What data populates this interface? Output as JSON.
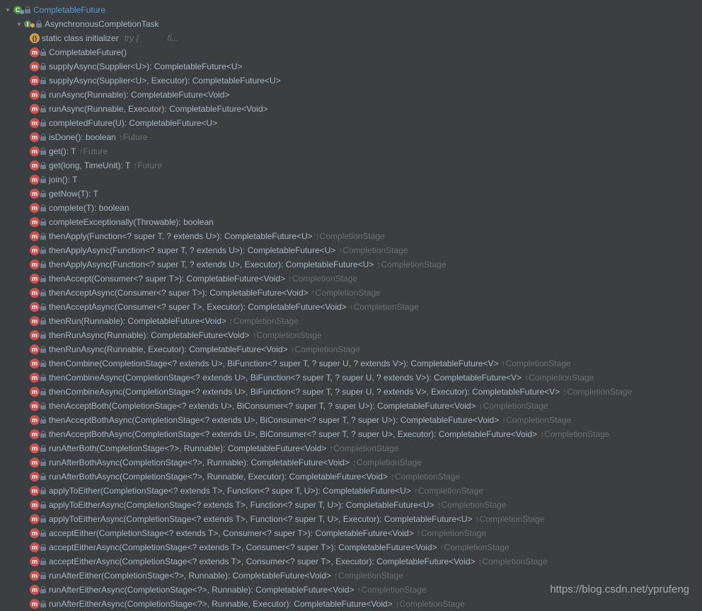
{
  "root": {
    "label": "CompletableFuture"
  },
  "sub": {
    "label": "AsynchronousCompletionTask"
  },
  "static_init": {
    "label": "static class initializer",
    "ghost1": "try {",
    "ghost2": "fi..."
  },
  "members": [
    {
      "sig": "CompletableFuture()",
      "kind": "m",
      "inherit": ""
    },
    {
      "sig": "supplyAsync(Supplier<U>): CompletableFuture<U>",
      "kind": "m",
      "inherit": ""
    },
    {
      "sig": "supplyAsync(Supplier<U>, Executor): CompletableFuture<U>",
      "kind": "m",
      "inherit": ""
    },
    {
      "sig": "runAsync(Runnable): CompletableFuture<Void>",
      "kind": "m",
      "inherit": ""
    },
    {
      "sig": "runAsync(Runnable, Executor): CompletableFuture<Void>",
      "kind": "m",
      "inherit": ""
    },
    {
      "sig": "completedFuture(U): CompletableFuture<U>",
      "kind": "m",
      "inherit": ""
    },
    {
      "sig": "isDone(): boolean",
      "kind": "m",
      "inherit": "Future"
    },
    {
      "sig": "get(): T",
      "kind": "m",
      "inherit": "Future"
    },
    {
      "sig": "get(long, TimeUnit): T",
      "kind": "m",
      "inherit": "Future"
    },
    {
      "sig": "join(): T",
      "kind": "m",
      "inherit": ""
    },
    {
      "sig": "getNow(T): T",
      "kind": "m",
      "inherit": ""
    },
    {
      "sig": "complete(T): boolean",
      "kind": "m",
      "inherit": ""
    },
    {
      "sig": "completeExceptionally(Throwable): boolean",
      "kind": "m",
      "inherit": ""
    },
    {
      "sig": "thenApply(Function<? super T, ? extends U>): CompletableFuture<U>",
      "kind": "m",
      "inherit": "CompletionStage"
    },
    {
      "sig": "thenApplyAsync(Function<? super T, ? extends U>): CompletableFuture<U>",
      "kind": "m",
      "inherit": "CompletionStage"
    },
    {
      "sig": "thenApplyAsync(Function<? super T, ? extends U>, Executor): CompletableFuture<U>",
      "kind": "m",
      "inherit": "CompletionStage"
    },
    {
      "sig": "thenAccept(Consumer<? super T>): CompletableFuture<Void>",
      "kind": "m",
      "inherit": "CompletionStage"
    },
    {
      "sig": "thenAcceptAsync(Consumer<? super T>): CompletableFuture<Void>",
      "kind": "m",
      "inherit": "CompletionStage"
    },
    {
      "sig": "thenAcceptAsync(Consumer<? super T>, Executor): CompletableFuture<Void>",
      "kind": "m",
      "inherit": "CompletionStage"
    },
    {
      "sig": "thenRun(Runnable): CompletableFuture<Void>",
      "kind": "m",
      "inherit": "CompletionStage"
    },
    {
      "sig": "thenRunAsync(Runnable): CompletableFuture<Void>",
      "kind": "m",
      "inherit": "CompletionStage"
    },
    {
      "sig": "thenRunAsync(Runnable, Executor): CompletableFuture<Void>",
      "kind": "m",
      "inherit": "CompletionStage"
    },
    {
      "sig": "thenCombine(CompletionStage<? extends U>, BiFunction<? super T, ? super U, ? extends V>): CompletableFuture<V>",
      "kind": "m",
      "inherit": "CompletionStage"
    },
    {
      "sig": "thenCombineAsync(CompletionStage<? extends U>, BiFunction<? super T, ? super U, ? extends V>): CompletableFuture<V>",
      "kind": "m",
      "inherit": "CompletionStage"
    },
    {
      "sig": "thenCombineAsync(CompletionStage<? extends U>, BiFunction<? super T, ? super U, ? extends V>, Executor): CompletableFuture<V>",
      "kind": "m",
      "inherit": "CompletionStage"
    },
    {
      "sig": "thenAcceptBoth(CompletionStage<? extends U>, BiConsumer<? super T, ? super U>): CompletableFuture<Void>",
      "kind": "m",
      "inherit": "CompletionStage"
    },
    {
      "sig": "thenAcceptBothAsync(CompletionStage<? extends U>, BiConsumer<? super T, ? super U>): CompletableFuture<Void>",
      "kind": "m",
      "inherit": "CompletionStage"
    },
    {
      "sig": "thenAcceptBothAsync(CompletionStage<? extends U>, BiConsumer<? super T, ? super U>, Executor): CompletableFuture<Void>",
      "kind": "m",
      "inherit": "CompletionStage"
    },
    {
      "sig": "runAfterBoth(CompletionStage<?>, Runnable): CompletableFuture<Void>",
      "kind": "m",
      "inherit": "CompletionStage"
    },
    {
      "sig": "runAfterBothAsync(CompletionStage<?>, Runnable): CompletableFuture<Void>",
      "kind": "m",
      "inherit": "CompletionStage"
    },
    {
      "sig": "runAfterBothAsync(CompletionStage<?>, Runnable, Executor): CompletableFuture<Void>",
      "kind": "m",
      "inherit": "CompletionStage"
    },
    {
      "sig": "applyToEither(CompletionStage<? extends T>, Function<? super T, U>): CompletableFuture<U>",
      "kind": "m",
      "inherit": "CompletionStage"
    },
    {
      "sig": "applyToEitherAsync(CompletionStage<? extends T>, Function<? super T, U>): CompletableFuture<U>",
      "kind": "m",
      "inherit": "CompletionStage"
    },
    {
      "sig": "applyToEitherAsync(CompletionStage<? extends T>, Function<? super T, U>, Executor): CompletableFuture<U>",
      "kind": "m",
      "inherit": "CompletionStage"
    },
    {
      "sig": "acceptEither(CompletionStage<? extends T>, Consumer<? super T>): CompletableFuture<Void>",
      "kind": "m",
      "inherit": "CompletionStage"
    },
    {
      "sig": "acceptEitherAsync(CompletionStage<? extends T>, Consumer<? super T>): CompletableFuture<Void>",
      "kind": "m",
      "inherit": "CompletionStage"
    },
    {
      "sig": "acceptEitherAsync(CompletionStage<? extends T>, Consumer<? super T>, Executor): CompletableFuture<Void>",
      "kind": "m",
      "inherit": "CompletionStage"
    },
    {
      "sig": "runAfterEither(CompletionStage<?>, Runnable): CompletableFuture<Void>",
      "kind": "m",
      "inherit": "CompletionStage"
    },
    {
      "sig": "runAfterEitherAsync(CompletionStage<?>, Runnable): CompletableFuture<Void>",
      "kind": "m",
      "inherit": "CompletionStage"
    },
    {
      "sig": "runAfterEitherAsync(CompletionStage<?>, Runnable, Executor): CompletableFuture<Void>",
      "kind": "m",
      "inherit": "CompletionStage"
    }
  ],
  "watermark": "https://blog.csdn.net/yprufeng"
}
